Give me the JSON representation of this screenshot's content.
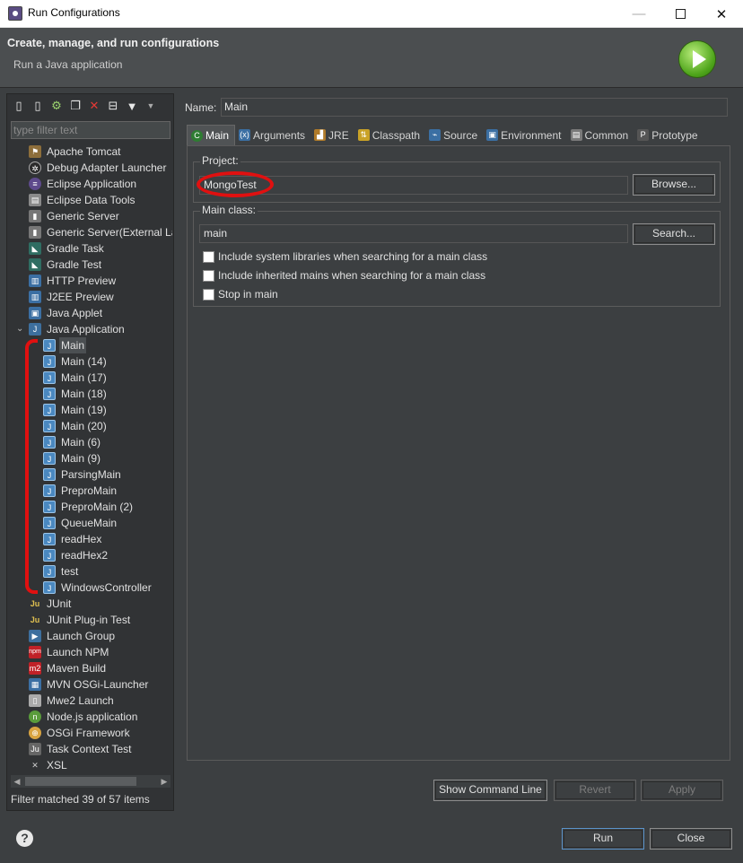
{
  "window": {
    "title": "Run Configurations",
    "min_glyph": "—",
    "close_glyph": "✕"
  },
  "header": {
    "title": "Create, manage, and run configurations",
    "subtitle": "Run a Java application"
  },
  "left": {
    "toolbar_icons": [
      "new-config-icon",
      "new-prototype-icon",
      "export-icon",
      "duplicate-icon",
      "delete-icon",
      "collapse-all-icon",
      "filter-icon",
      "view-menu-icon"
    ],
    "filter_placeholder": "type filter text",
    "tree": [
      {
        "label": "Apache Tomcat",
        "icon": "tomcat-icon",
        "glyph": "⚑",
        "cls": "ico-tom",
        "level": 1
      },
      {
        "label": "Debug Adapter Launcher",
        "icon": "debug-adapter-icon",
        "glyph": "✲",
        "cls": "ico-dbg",
        "level": 1
      },
      {
        "label": "Eclipse Application",
        "icon": "eclipse-icon",
        "glyph": "≡",
        "cls": "ico-ecl",
        "level": 1
      },
      {
        "label": "Eclipse Data Tools",
        "icon": "data-tools-icon",
        "glyph": "▤",
        "cls": "ico-db",
        "level": 1
      },
      {
        "label": "Generic Server",
        "icon": "server-icon",
        "glyph": "▮",
        "cls": "ico-srv",
        "level": 1
      },
      {
        "label": "Generic Server(External La",
        "icon": "server-external-icon",
        "glyph": "▮",
        "cls": "ico-srv",
        "level": 1
      },
      {
        "label": "Gradle Task",
        "icon": "gradle-icon",
        "glyph": "◣",
        "cls": "ico-grd",
        "level": 1
      },
      {
        "label": "Gradle Test",
        "icon": "gradle-icon",
        "glyph": "◣",
        "cls": "ico-grd",
        "level": 1
      },
      {
        "label": "HTTP Preview",
        "icon": "http-preview-icon",
        "glyph": "▥",
        "cls": "ico-web",
        "level": 1
      },
      {
        "label": "J2EE Preview",
        "icon": "j2ee-preview-icon",
        "glyph": "▥",
        "cls": "ico-web",
        "level": 1
      },
      {
        "label": "Java Applet",
        "icon": "java-applet-icon",
        "glyph": "▣",
        "cls": "ico-app",
        "level": 1
      },
      {
        "label": "Java Application",
        "icon": "java-application-icon",
        "glyph": "J",
        "cls": "ico-j",
        "level": 1,
        "expanded": true
      },
      {
        "label": "Main",
        "icon": "java-config-icon",
        "glyph": "J",
        "cls": "ico-j2",
        "level": 2,
        "selected": true
      },
      {
        "label": "Main (14)",
        "icon": "java-config-icon",
        "glyph": "J",
        "cls": "ico-j2",
        "level": 2
      },
      {
        "label": "Main (17)",
        "icon": "java-config-icon",
        "glyph": "J",
        "cls": "ico-j2",
        "level": 2
      },
      {
        "label": "Main (18)",
        "icon": "java-config-icon",
        "glyph": "J",
        "cls": "ico-j2",
        "level": 2
      },
      {
        "label": "Main (19)",
        "icon": "java-config-icon",
        "glyph": "J",
        "cls": "ico-j2",
        "level": 2
      },
      {
        "label": "Main (20)",
        "icon": "java-config-icon",
        "glyph": "J",
        "cls": "ico-j2",
        "level": 2
      },
      {
        "label": "Main (6)",
        "icon": "java-config-icon",
        "glyph": "J",
        "cls": "ico-j2",
        "level": 2
      },
      {
        "label": "Main (9)",
        "icon": "java-config-icon",
        "glyph": "J",
        "cls": "ico-j2",
        "level": 2
      },
      {
        "label": "ParsingMain",
        "icon": "java-config-icon",
        "glyph": "J",
        "cls": "ico-j2",
        "level": 2
      },
      {
        "label": "PreproMain",
        "icon": "java-config-icon",
        "glyph": "J",
        "cls": "ico-j2",
        "level": 2
      },
      {
        "label": "PreproMain (2)",
        "icon": "java-config-icon",
        "glyph": "J",
        "cls": "ico-j2",
        "level": 2
      },
      {
        "label": "QueueMain",
        "icon": "java-config-icon",
        "glyph": "J",
        "cls": "ico-j2",
        "level": 2
      },
      {
        "label": "readHex",
        "icon": "java-config-icon",
        "glyph": "J",
        "cls": "ico-j2",
        "level": 2
      },
      {
        "label": "readHex2",
        "icon": "java-config-icon",
        "glyph": "J",
        "cls": "ico-j2",
        "level": 2
      },
      {
        "label": "test",
        "icon": "java-config-icon",
        "glyph": "J",
        "cls": "ico-j2",
        "level": 2
      },
      {
        "label": "WindowsController",
        "icon": "java-config-icon",
        "glyph": "J",
        "cls": "ico-j2",
        "level": 2
      },
      {
        "label": "JUnit",
        "icon": "junit-icon",
        "glyph": "Ju",
        "cls": "ico-ju",
        "level": 1
      },
      {
        "label": "JUnit Plug-in Test",
        "icon": "junit-plugin-icon",
        "glyph": "Ju",
        "cls": "ico-ju",
        "level": 1
      },
      {
        "label": "Launch Group",
        "icon": "launch-group-icon",
        "glyph": "▶",
        "cls": "ico-grp",
        "level": 1
      },
      {
        "label": "Launch NPM",
        "icon": "npm-icon",
        "glyph": "npm",
        "cls": "ico-npm",
        "level": 1
      },
      {
        "label": "Maven Build",
        "icon": "maven-icon",
        "glyph": "m2",
        "cls": "ico-m2",
        "level": 1
      },
      {
        "label": "MVN OSGi-Launcher",
        "icon": "mvn-osgi-icon",
        "glyph": "▦",
        "cls": "ico-mvn",
        "level": 1
      },
      {
        "label": "Mwe2 Launch",
        "icon": "mwe2-icon",
        "glyph": "▯",
        "cls": "ico-mwe",
        "level": 1
      },
      {
        "label": "Node.js application",
        "icon": "nodejs-icon",
        "glyph": "n",
        "cls": "ico-node",
        "level": 1
      },
      {
        "label": "OSGi Framework",
        "icon": "osgi-icon",
        "glyph": "⊕",
        "cls": "ico-osgi",
        "level": 1
      },
      {
        "label": "Task Context Test",
        "icon": "task-context-icon",
        "glyph": "Ju",
        "cls": "ico-task",
        "level": 1
      },
      {
        "label": "XSL",
        "icon": "xsl-icon",
        "glyph": "✕",
        "cls": "ico-xsl",
        "level": 1
      }
    ],
    "filter_status": "Filter matched 39 of 57 items"
  },
  "right": {
    "name_label": "Name:",
    "name_value": "Main",
    "tabs": [
      {
        "label": "Main",
        "icon": "main-tab-icon",
        "glyph": "C",
        "color": "#2e7d32",
        "active": true
      },
      {
        "label": "Arguments",
        "icon": "arguments-icon",
        "glyph": "(x)",
        "color": "#3b6fa3"
      },
      {
        "label": "JRE",
        "icon": "jre-icon",
        "glyph": "▟",
        "color": "#b07b2a"
      },
      {
        "label": "Classpath",
        "icon": "classpath-icon",
        "glyph": "⇅",
        "color": "#c9a227"
      },
      {
        "label": "Source",
        "icon": "source-icon",
        "glyph": "⌁",
        "color": "#3b6fa3"
      },
      {
        "label": "Environment",
        "icon": "environment-icon",
        "glyph": "▣",
        "color": "#3b6fa3"
      },
      {
        "label": "Common",
        "icon": "common-icon",
        "glyph": "▤",
        "color": "#7a7a7a"
      },
      {
        "label": "Prototype",
        "icon": "prototype-icon",
        "glyph": "P",
        "color": "#555555"
      }
    ],
    "project": {
      "label": "Project:",
      "value": "MongoTest",
      "browse": "Browse..."
    },
    "main_class": {
      "label": "Main class:",
      "value": "main",
      "search": "Search..."
    },
    "checkboxes": [
      "Include system libraries when searching for a main class",
      "Include inherited mains when searching for a main class",
      "Stop in main"
    ],
    "buttons": {
      "show_command_line": "Show Command Line",
      "revert": "Revert",
      "apply": "Apply"
    }
  },
  "footer": {
    "help": "?",
    "run": "Run",
    "close": "Close"
  },
  "annotation_color": "#e01010"
}
